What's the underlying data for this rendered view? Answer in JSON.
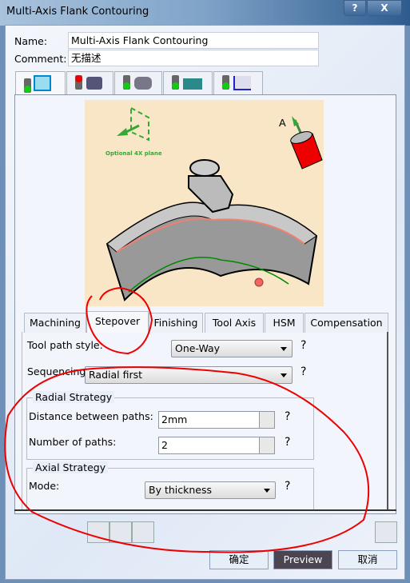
{
  "window": {
    "title": "Multi-Axis Flank Contouring",
    "help_label": "?",
    "close_label": "X"
  },
  "form": {
    "name_label": "Name:",
    "name_value": "Multi-Axis Flank Contouring",
    "comment_label": "Comment:",
    "comment_value": "无描述"
  },
  "icon_tabs": [
    {
      "icon": "strategy-icon",
      "status": "green"
    },
    {
      "icon": "geometry-icon",
      "status": "red"
    },
    {
      "icon": "tool-icon",
      "status": "green"
    },
    {
      "icon": "feeds-speeds-icon",
      "status": "green"
    },
    {
      "icon": "macros-icon",
      "status": "green"
    }
  ],
  "illustration": {
    "plane_label": "Optional 4X plane",
    "axis_label": "A"
  },
  "tabs": [
    "Machining",
    "Stepover",
    "Finishing",
    "Tool Axis",
    "HSM",
    "Compensation"
  ],
  "active_tab": "Stepover",
  "stepover": {
    "tool_path_style_label": "Tool path style:",
    "tool_path_style_value": "One-Way",
    "sequencing_label": "Sequencing:",
    "sequencing_value": "Radial first",
    "radial_title": "Radial Strategy",
    "distance_label": "Distance between paths:",
    "distance_value": "2mm",
    "number_label": "Number of paths:",
    "number_value": "2",
    "axial_title": "Axial Strategy",
    "mode_label": "Mode:",
    "mode_value": "By thickness",
    "help": "?"
  },
  "buttons": {
    "ok": "确定",
    "preview": "Preview",
    "cancel": "取消"
  },
  "colors": {
    "annotation": "#e00000",
    "illustration_bg": "#f8e6c6"
  }
}
